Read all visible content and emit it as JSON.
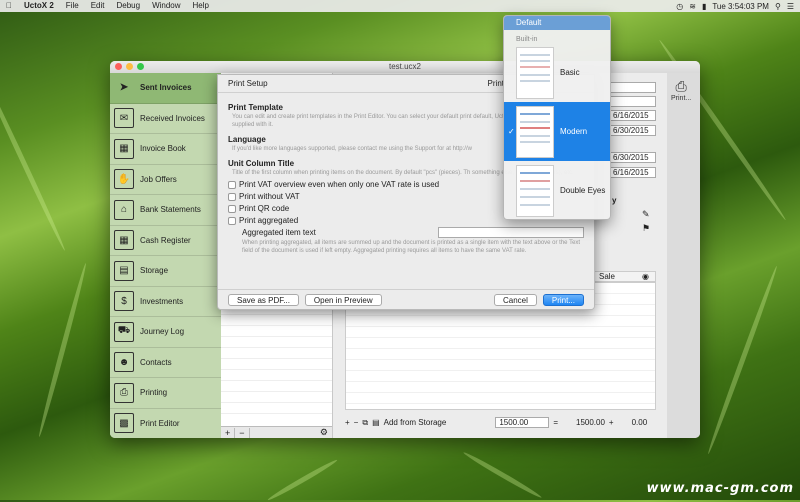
{
  "menubar": {
    "app": "UctoX 2",
    "items": [
      "File",
      "Edit",
      "Debug",
      "Window",
      "Help"
    ],
    "clock": "Tue 3:54:03 PM"
  },
  "window": {
    "title": "test.ucx2"
  },
  "sidebar": {
    "items": [
      {
        "label": "Sent Invoices",
        "icon": "paper-plane-icon"
      },
      {
        "label": "Received Invoices",
        "icon": "envelope-icon"
      },
      {
        "label": "Invoice Book",
        "icon": "binder-icon"
      },
      {
        "label": "Job Offers",
        "icon": "hand-box-icon"
      },
      {
        "label": "Bank Statements",
        "icon": "bank-icon"
      },
      {
        "label": "Cash Register",
        "icon": "cash-register-icon"
      },
      {
        "label": "Storage",
        "icon": "cabinet-icon"
      },
      {
        "label": "Investments",
        "icon": "dollar-icon"
      },
      {
        "label": "Journey Log",
        "icon": "truck-icon"
      },
      {
        "label": "Contacts",
        "icon": "contact-card-icon"
      },
      {
        "label": "Printing",
        "icon": "printer-icon"
      },
      {
        "label": "Print Editor",
        "icon": "print-editor-icon"
      }
    ]
  },
  "sheet": {
    "title": "Print Setup",
    "title_right": "Print",
    "template_label": "Print Template",
    "template_desc": "You can edit and create print templates in the Print Editor. You can select your default print default, UctoX uses a template that is supplied with it.",
    "language_label": "Language",
    "language_desc": "If you'd like more languages supported, please contact me using the Support for at http://w",
    "unit_label": "Unit Column Title",
    "unit_desc": "Title of the first column when printing items on the document. By default \"pcs\" (pieces). Th something else, e.g. \"hrs\" (hours), etc.",
    "checks": [
      "Print VAT overview even when only one VAT rate is used",
      "Print without VAT",
      "Print QR code",
      "Print aggregated"
    ],
    "agg_label": "Aggregated item text",
    "agg_value": "",
    "agg_desc": "When printing aggregated, all items are summed up and the document is printed as a single item with the text above or the Text field of the document is used if left empty. Aggregated printing requires all items to have the same VAT rate.",
    "buttons": {
      "save_pdf": "Save as PDF...",
      "preview": "Open in Preview",
      "cancel": "Cancel",
      "print": "Print..."
    }
  },
  "popup": {
    "default": "Default",
    "group": "Built-in",
    "items": [
      "Basic",
      "Modern",
      "Double Eyes"
    ],
    "selected": "Modern"
  },
  "content": {
    "dates": [
      "6/16/2015",
      "6/30/2015",
      "6/30/2015",
      "6/16/2015"
    ],
    "table_header": "Sale",
    "side_label": "y",
    "add_storage": "Add from Storage",
    "qty": "1500.00",
    "eq": "=",
    "total": "1500.00",
    "plus": "+",
    "zero": "0.00",
    "print_button": "Print..."
  },
  "watermark": "www.mac-gm.com"
}
